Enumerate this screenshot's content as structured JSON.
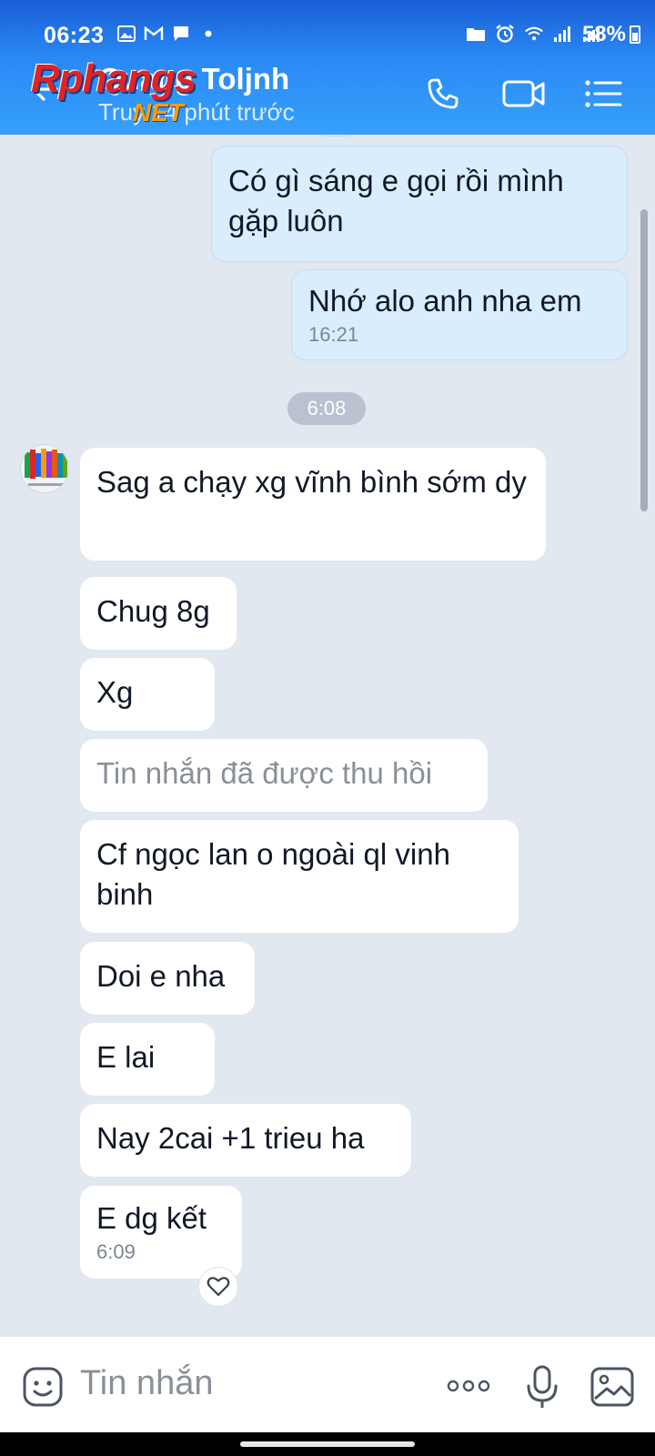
{
  "status_bar": {
    "time": "06:23",
    "battery": "58%"
  },
  "header": {
    "contact_name": "Quang Toljnh",
    "status": "Truy 14 phút trước",
    "watermark_top": "Rphangs",
    "watermark_bottom": "NET"
  },
  "icons": {
    "back": "back-arrow-icon",
    "call": "phone-icon",
    "video": "video-camera-icon",
    "menu": "list-menu-icon",
    "emoji": "emoji-icon",
    "more": "more-dots-icon",
    "mic": "microphone-icon",
    "image": "image-icon",
    "heart": "heart-icon"
  },
  "messages_sent": [
    {
      "text": "Có gì sáng e gọi rồi mình gặp luôn"
    },
    {
      "text": "Nhớ alo anh nha em",
      "time": "16:21"
    }
  ],
  "time_divider": "6:08",
  "messages_received": [
    {
      "text": "Sag a chạy xg vĩnh bình sớm dy"
    },
    {
      "text": "Chug 8g"
    },
    {
      "text": "Xg"
    },
    {
      "text": "Tin nhắn đã được thu hồi"
    },
    {
      "text": "Cf ngọc lan o ngoài ql vinh binh"
    },
    {
      "text": "Doi e nha"
    },
    {
      "text": "E lai"
    },
    {
      "text": "Nay 2cai +1 trieu ha"
    },
    {
      "text": "E dg kết",
      "time": "6:09"
    }
  ],
  "input": {
    "placeholder": "Tin nhắn"
  },
  "colors": {
    "header_blue": "#2a8af5",
    "sent_bubble": "#d9edfd",
    "received_bubble": "#ffffff",
    "chat_bg": "#e2e8f0"
  }
}
